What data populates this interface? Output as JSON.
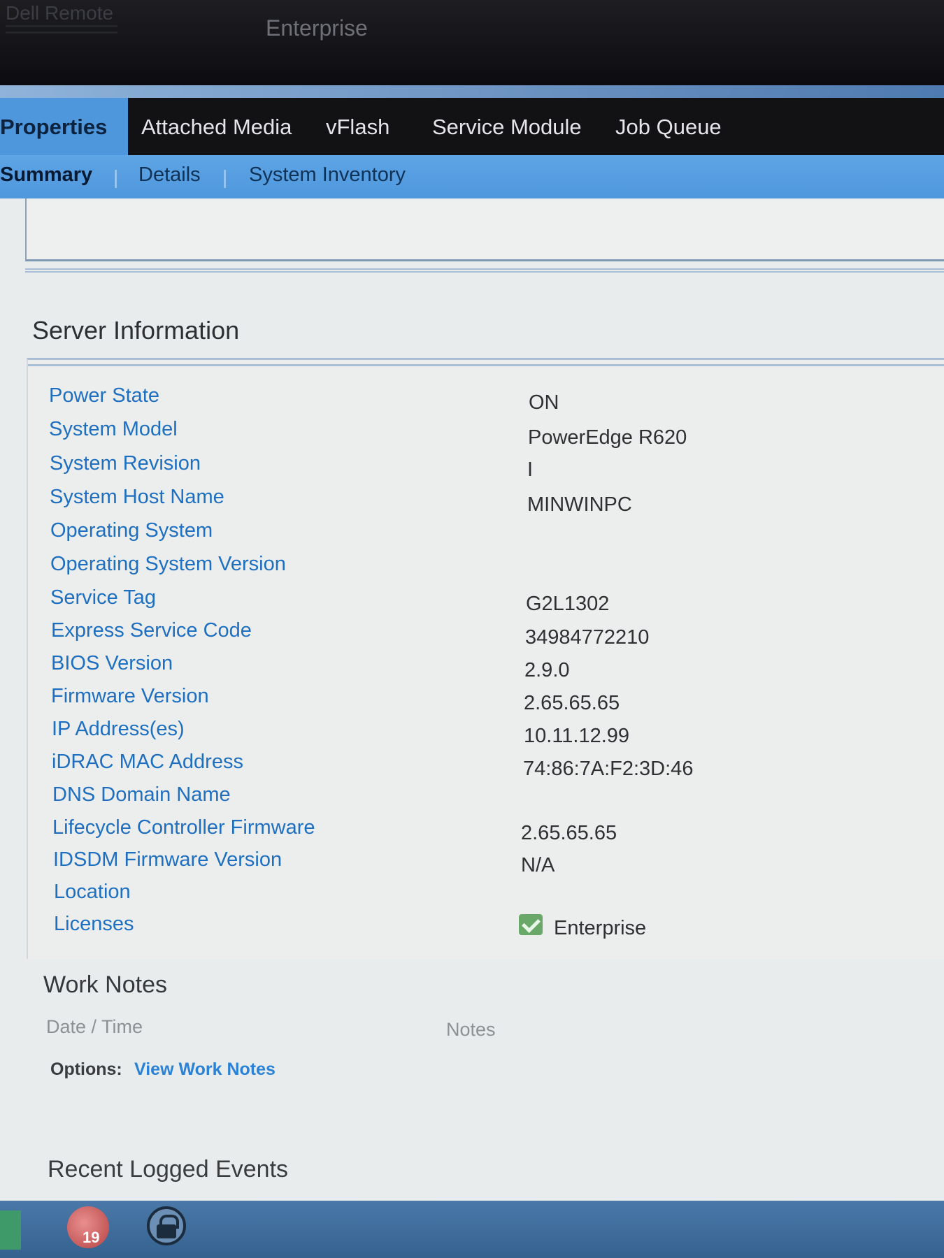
{
  "header": {
    "brand": "Dell Remote",
    "edition": "Enterprise"
  },
  "tabs": [
    "Properties",
    "Attached Media",
    "vFlash",
    "Service Module",
    "Job Queue"
  ],
  "subtabs": [
    "Summary",
    "Details",
    "System Inventory"
  ],
  "server_info": {
    "title": "Server Information",
    "rows": [
      {
        "label": "Power State",
        "value": "ON"
      },
      {
        "label": "System Model",
        "value": "PowerEdge R620"
      },
      {
        "label": "System Revision",
        "value": "I"
      },
      {
        "label": "System Host Name",
        "value": "MINWINPC"
      },
      {
        "label": "Operating System",
        "value": ""
      },
      {
        "label": "Operating System Version",
        "value": ""
      },
      {
        "label": "Service Tag",
        "value": "G2L1302"
      },
      {
        "label": "Express Service Code",
        "value": "34984772210"
      },
      {
        "label": "BIOS Version",
        "value": "2.9.0"
      },
      {
        "label": "Firmware Version",
        "value": "2.65.65.65"
      },
      {
        "label": "IP Address(es)",
        "value": "10.11.12.99"
      },
      {
        "label": "iDRAC MAC Address",
        "value": "74:86:7A:F2:3D:46"
      },
      {
        "label": "DNS Domain Name",
        "value": ""
      },
      {
        "label": "Lifecycle Controller Firmware",
        "value": "2.65.65.65"
      },
      {
        "label": "IDSDM Firmware Version",
        "value": "N/A"
      },
      {
        "label": "Location",
        "value": ""
      },
      {
        "label": "Licenses",
        "value": "Enterprise"
      }
    ]
  },
  "work_notes": {
    "title": "Work Notes",
    "col_date": "Date / Time",
    "col_notes": "Notes",
    "options_label": "Options:",
    "options_link": "View Work Notes"
  },
  "recent_events": {
    "title": "Recent Logged Events"
  },
  "taskbar": {
    "badge": "19"
  }
}
